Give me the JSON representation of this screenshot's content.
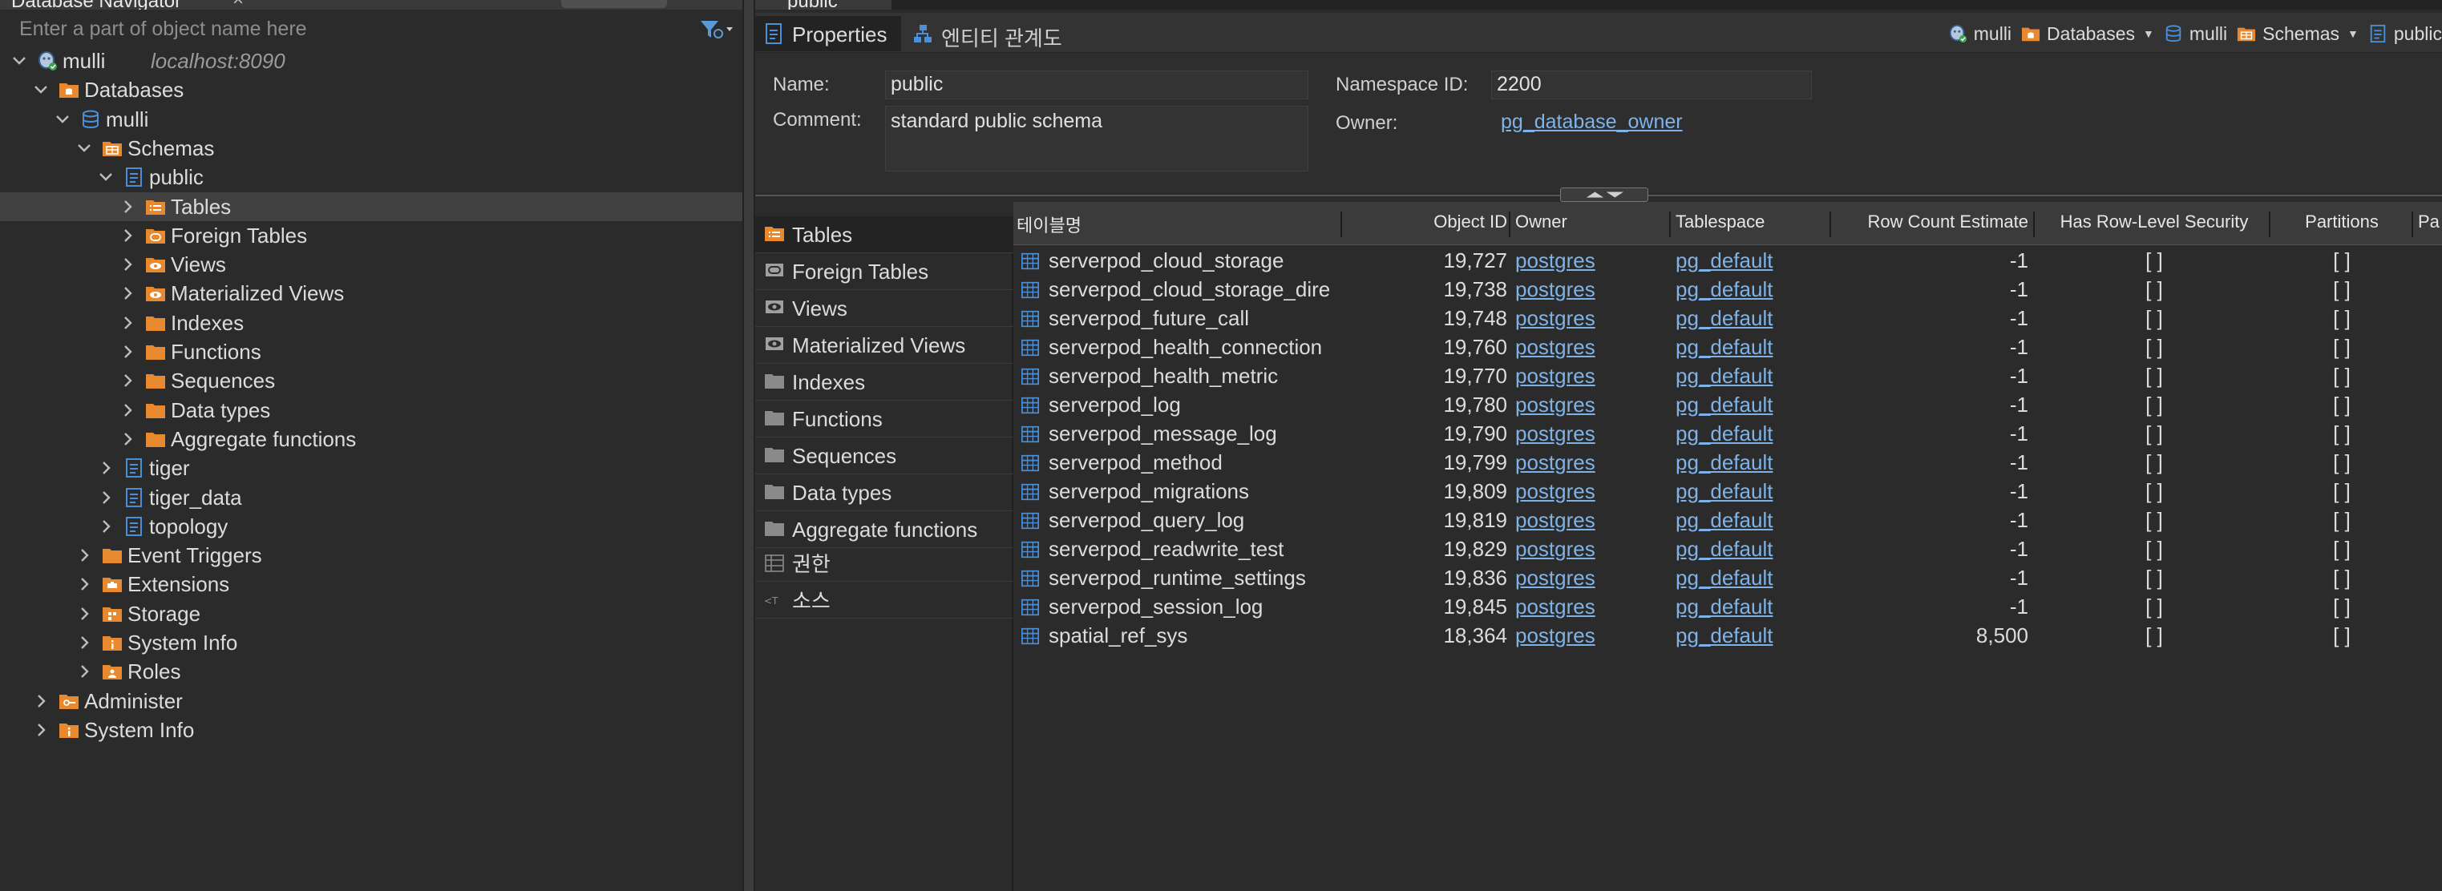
{
  "navigator": {
    "tab_title": "Database Navigator",
    "filter_placeholder": "Enter a part of object name here",
    "tree": [
      {
        "label": "mulli",
        "sub": "localhost:8090",
        "depth": 0,
        "expanded": true,
        "icon": "postgres-icon"
      },
      {
        "label": "Databases",
        "depth": 1,
        "expanded": true,
        "icon": "databases-folder-icon"
      },
      {
        "label": "mulli",
        "depth": 2,
        "expanded": true,
        "icon": "database-icon"
      },
      {
        "label": "Schemas",
        "depth": 3,
        "expanded": true,
        "icon": "schemas-folder-icon"
      },
      {
        "label": "public",
        "depth": 4,
        "expanded": true,
        "icon": "schema-icon"
      },
      {
        "label": "Tables",
        "depth": 5,
        "expanded": false,
        "icon": "tables-folder-icon",
        "selected": true
      },
      {
        "label": "Foreign Tables",
        "depth": 5,
        "expanded": false,
        "icon": "foreign-tables-folder-icon"
      },
      {
        "label": "Views",
        "depth": 5,
        "expanded": false,
        "icon": "views-folder-icon"
      },
      {
        "label": "Materialized Views",
        "depth": 5,
        "expanded": false,
        "icon": "materialized-views-folder-icon"
      },
      {
        "label": "Indexes",
        "depth": 5,
        "expanded": false,
        "icon": "folder-icon"
      },
      {
        "label": "Functions",
        "depth": 5,
        "expanded": false,
        "icon": "folder-icon"
      },
      {
        "label": "Sequences",
        "depth": 5,
        "expanded": false,
        "icon": "folder-icon"
      },
      {
        "label": "Data types",
        "depth": 5,
        "expanded": false,
        "icon": "folder-icon"
      },
      {
        "label": "Aggregate functions",
        "depth": 5,
        "expanded": false,
        "icon": "folder-icon"
      },
      {
        "label": "tiger",
        "depth": 4,
        "expanded": false,
        "icon": "schema-icon"
      },
      {
        "label": "tiger_data",
        "depth": 4,
        "expanded": false,
        "icon": "schema-icon"
      },
      {
        "label": "topology",
        "depth": 4,
        "expanded": false,
        "icon": "schema-icon"
      },
      {
        "label": "Event Triggers",
        "depth": 3,
        "expanded": false,
        "icon": "folder-icon"
      },
      {
        "label": "Extensions",
        "depth": 3,
        "expanded": false,
        "icon": "extensions-folder-icon"
      },
      {
        "label": "Storage",
        "depth": 3,
        "expanded": false,
        "icon": "storage-folder-icon"
      },
      {
        "label": "System Info",
        "depth": 3,
        "expanded": false,
        "icon": "info-folder-icon"
      },
      {
        "label": "Roles",
        "depth": 3,
        "expanded": false,
        "icon": "roles-folder-icon"
      },
      {
        "label": "Administer",
        "depth": 1,
        "expanded": false,
        "icon": "administer-folder-icon"
      },
      {
        "label": "System Info",
        "depth": 1,
        "expanded": false,
        "icon": "info-folder-icon"
      }
    ]
  },
  "editor": {
    "tab_title": "public",
    "view_tabs": [
      {
        "label": "Properties",
        "active": true,
        "icon": "properties-icon"
      },
      {
        "label": "엔티티 관계도",
        "active": false,
        "icon": "er-diagram-icon"
      }
    ],
    "breadcrumb": [
      {
        "label": "mulli",
        "icon": "postgres-icon",
        "dropdown": false
      },
      {
        "label": "Databases",
        "icon": "databases-folder-icon",
        "dropdown": true
      },
      {
        "label": "mulli",
        "icon": "database-icon",
        "dropdown": false
      },
      {
        "label": "Schemas",
        "icon": "schemas-folder-icon",
        "dropdown": true
      },
      {
        "label": "public",
        "icon": "schema-icon",
        "dropdown": false
      }
    ],
    "properties": {
      "name_label": "Name:",
      "name_value": "public",
      "comment_label": "Comment:",
      "comment_value": "standard public schema",
      "namespace_label": "Namespace ID:",
      "namespace_value": "2200",
      "owner_label": "Owner:",
      "owner_value": "pg_database_owner"
    },
    "object_types": [
      {
        "label": "Tables",
        "icon": "tables-folder-icon",
        "selected": true
      },
      {
        "label": "Foreign Tables",
        "icon": "foreign-tables-icon"
      },
      {
        "label": "Views",
        "icon": "views-icon"
      },
      {
        "label": "Materialized Views",
        "icon": "materialized-views-icon"
      },
      {
        "label": "Indexes",
        "icon": "gray-folder-icon"
      },
      {
        "label": "Functions",
        "icon": "gray-folder-icon"
      },
      {
        "label": "Sequences",
        "icon": "gray-folder-icon"
      },
      {
        "label": "Data types",
        "icon": "gray-folder-icon"
      },
      {
        "label": "Aggregate functions",
        "icon": "gray-folder-icon"
      },
      {
        "label": "권한",
        "icon": "permissions-icon"
      },
      {
        "label": "소스",
        "icon": "source-icon"
      }
    ],
    "table": {
      "columns": [
        "테이블명",
        "Object ID",
        "Owner",
        "Tablespace",
        "Row Count Estimate",
        "Has Row-Level Security",
        "Partitions",
        "Pa"
      ],
      "rows": [
        [
          "serverpod_cloud_storage",
          "19,727",
          "postgres",
          "pg_default",
          "-1",
          "[ ]",
          "[ ]"
        ],
        [
          "serverpod_cloud_storage_dire",
          "19,738",
          "postgres",
          "pg_default",
          "-1",
          "[ ]",
          "[ ]"
        ],
        [
          "serverpod_future_call",
          "19,748",
          "postgres",
          "pg_default",
          "-1",
          "[ ]",
          "[ ]"
        ],
        [
          "serverpod_health_connection",
          "19,760",
          "postgres",
          "pg_default",
          "-1",
          "[ ]",
          "[ ]"
        ],
        [
          "serverpod_health_metric",
          "19,770",
          "postgres",
          "pg_default",
          "-1",
          "[ ]",
          "[ ]"
        ],
        [
          "serverpod_log",
          "19,780",
          "postgres",
          "pg_default",
          "-1",
          "[ ]",
          "[ ]"
        ],
        [
          "serverpod_message_log",
          "19,790",
          "postgres",
          "pg_default",
          "-1",
          "[ ]",
          "[ ]"
        ],
        [
          "serverpod_method",
          "19,799",
          "postgres",
          "pg_default",
          "-1",
          "[ ]",
          "[ ]"
        ],
        [
          "serverpod_migrations",
          "19,809",
          "postgres",
          "pg_default",
          "-1",
          "[ ]",
          "[ ]"
        ],
        [
          "serverpod_query_log",
          "19,819",
          "postgres",
          "pg_default",
          "-1",
          "[ ]",
          "[ ]"
        ],
        [
          "serverpod_readwrite_test",
          "19,829",
          "postgres",
          "pg_default",
          "-1",
          "[ ]",
          "[ ]"
        ],
        [
          "serverpod_runtime_settings",
          "19,836",
          "postgres",
          "pg_default",
          "-1",
          "[ ]",
          "[ ]"
        ],
        [
          "serverpod_session_log",
          "19,845",
          "postgres",
          "pg_default",
          "-1",
          "[ ]",
          "[ ]"
        ],
        [
          "spatial_ref_sys",
          "18,364",
          "postgres",
          "pg_default",
          "8,500",
          "[ ]",
          "[ ]"
        ]
      ]
    }
  },
  "colors": {
    "folder_orange": "#e8892f",
    "icon_blue": "#4a8fd8",
    "link_blue": "#7fb3e8",
    "background": "#2b2b2b"
  }
}
